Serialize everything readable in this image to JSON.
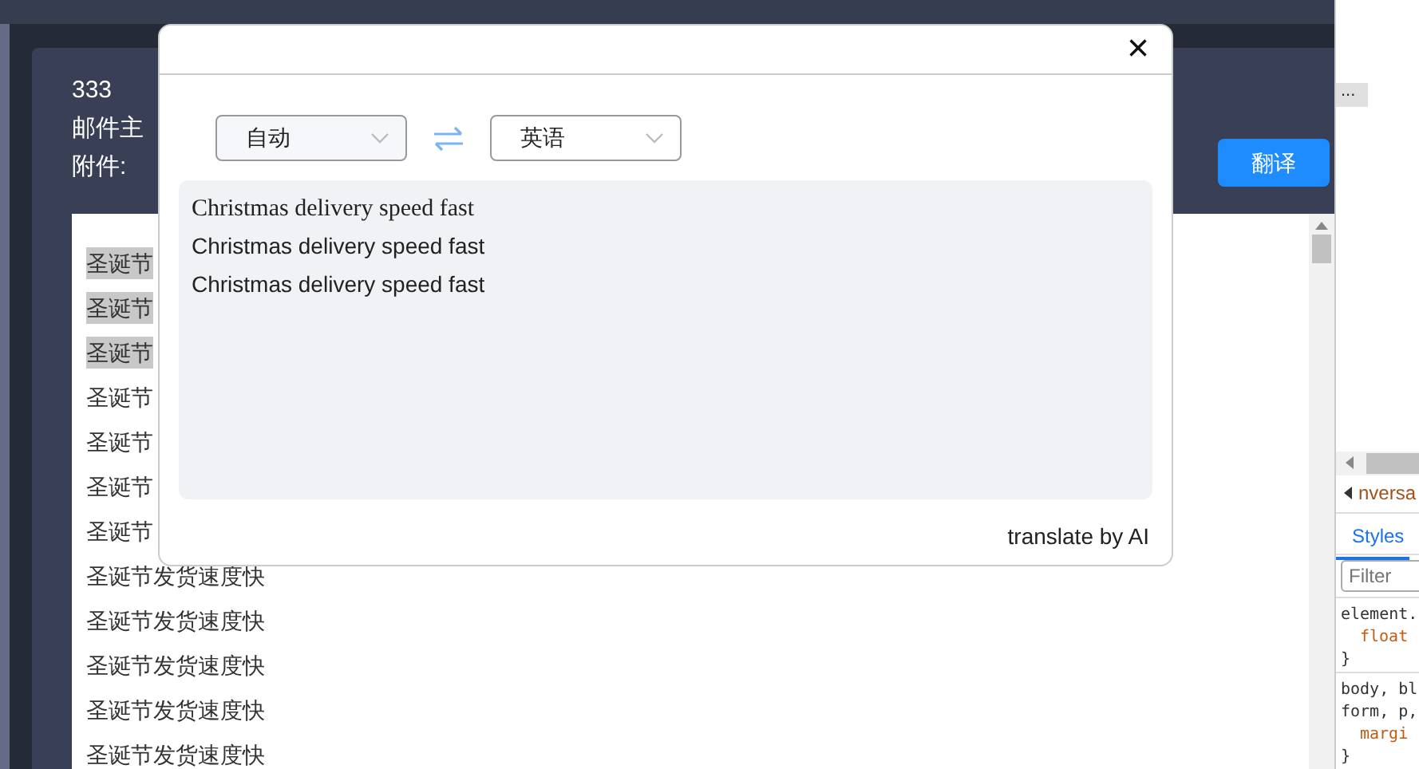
{
  "mail": {
    "header_lines": [
      "333",
      "邮件主",
      "附件:"
    ],
    "translate_button": "翻译",
    "lines": [
      {
        "text": "圣诞节",
        "highlighted": true
      },
      {
        "text": "圣诞节",
        "highlighted": true
      },
      {
        "text": "圣诞节",
        "highlighted": true
      },
      {
        "text": "圣诞节",
        "highlighted": false
      },
      {
        "text": "圣诞节",
        "highlighted": false
      },
      {
        "text": "圣诞节",
        "highlighted": false
      },
      {
        "text": "圣诞节",
        "highlighted": false
      },
      {
        "text": "圣诞节发货速度快",
        "highlighted": false
      },
      {
        "text": "圣诞节发货速度快",
        "highlighted": false
      },
      {
        "text": "圣诞节发货速度快",
        "highlighted": false
      },
      {
        "text": "圣诞节发货速度快",
        "highlighted": false
      },
      {
        "text": "圣诞节发货速度快",
        "highlighted": false
      }
    ]
  },
  "dialog": {
    "close": "×",
    "source_language": "自动",
    "target_language": "英语",
    "results": [
      {
        "text": "Christmas delivery speed fast",
        "kind": "serif"
      },
      {
        "text": "Christmas delivery speed fast",
        "kind": "sans"
      },
      {
        "text": "Christmas delivery speed fast",
        "kind": "sans"
      }
    ],
    "footer": "translate by AI"
  },
  "devtools": {
    "more": "...",
    "breadcrumb": "nversa",
    "tabs": [
      {
        "label": "Styles",
        "selected": true
      }
    ],
    "filter_placeholder": "Filter",
    "css_lines": [
      {
        "text": "element.",
        "kind": "selector"
      },
      {
        "text": "float",
        "kind": "property"
      },
      {
        "text": "}",
        "kind": "brace"
      },
      {
        "text": "body, bl",
        "kind": "selector"
      },
      {
        "text": "form, p,",
        "kind": "selector"
      },
      {
        "text": "margi",
        "kind": "property"
      },
      {
        "text": "}",
        "kind": "brace"
      }
    ]
  }
}
